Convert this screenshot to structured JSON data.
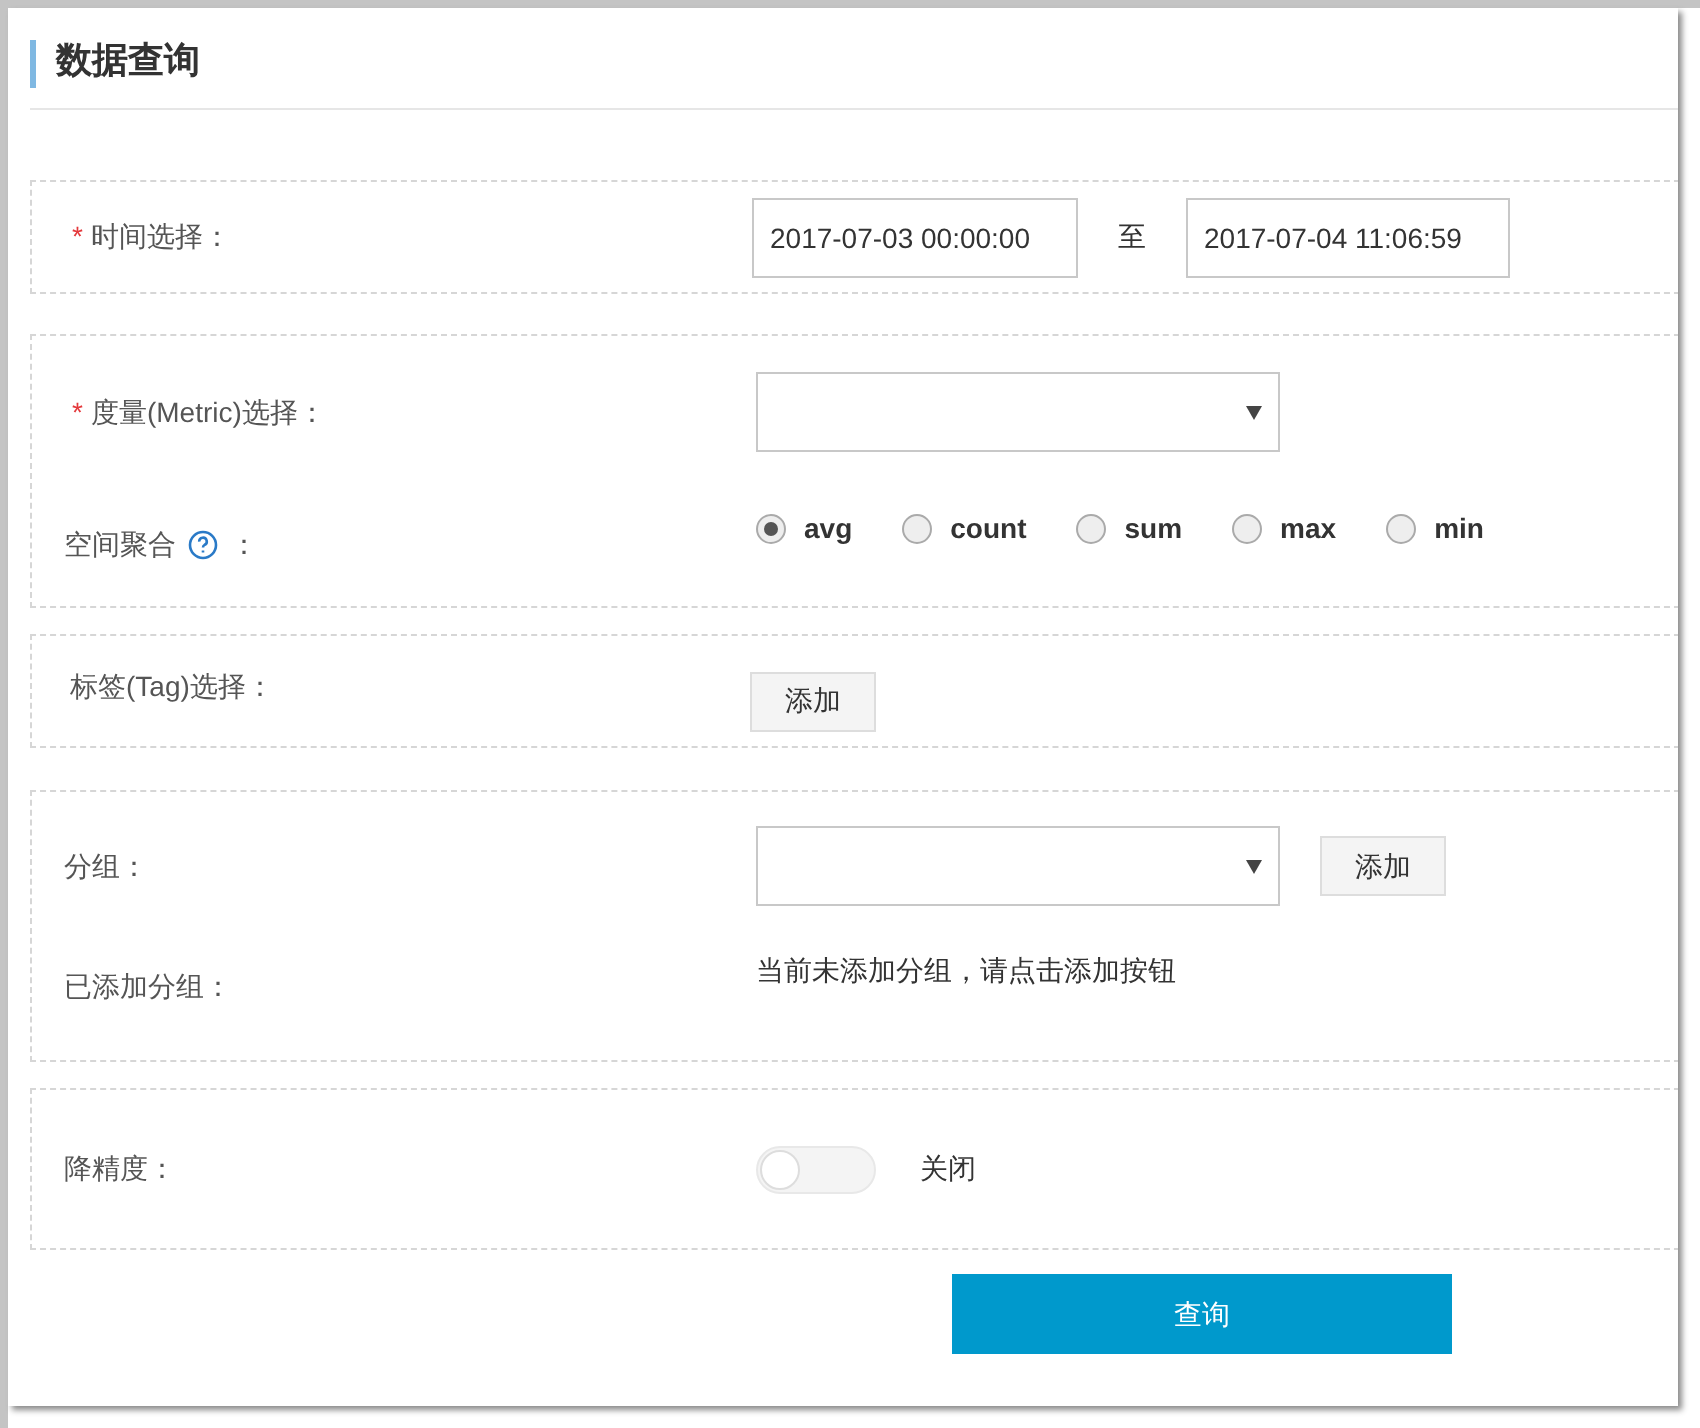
{
  "title": "数据查询",
  "time": {
    "required_mark": "*",
    "label": "时间选择：",
    "start": "2017-07-03 00:00:00",
    "separator": "至",
    "end": "2017-07-04 11:06:59"
  },
  "metric": {
    "required_mark": "*",
    "label": "度量(Metric)选择："
  },
  "aggregation": {
    "label": "空间聚合",
    "suffix": "：",
    "options": [
      {
        "label": "avg",
        "selected": true
      },
      {
        "label": "count",
        "selected": false
      },
      {
        "label": "sum",
        "selected": false
      },
      {
        "label": "max",
        "selected": false
      },
      {
        "label": "min",
        "selected": false
      }
    ]
  },
  "tag": {
    "label": "标签(Tag)选择：",
    "button": "添加"
  },
  "group": {
    "label": "分组：",
    "button": "添加",
    "added_label": "已添加分组：",
    "empty_text": "当前未添加分组，请点击添加按钮"
  },
  "downsample": {
    "label": "降精度：",
    "on": false,
    "state_text": "关闭"
  },
  "submit": "查询"
}
